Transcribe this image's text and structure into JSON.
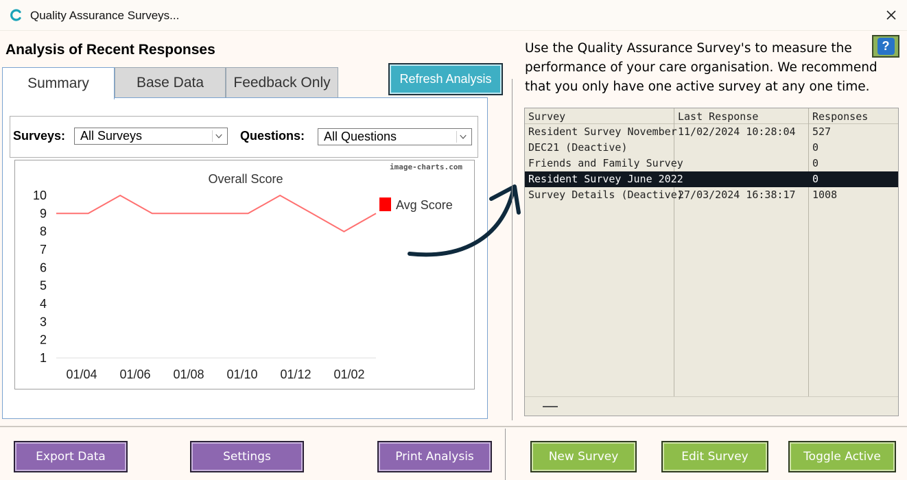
{
  "window": {
    "title": "Quality Assurance Surveys...",
    "close_label": "×"
  },
  "heading": "Analysis of Recent Responses",
  "tabs": [
    {
      "label": "Summary",
      "active": true
    },
    {
      "label": "Base Data",
      "active": false
    },
    {
      "label": "Feedback Only",
      "active": false
    }
  ],
  "refresh_button": "Refresh Analysis",
  "filters": {
    "surveys_label": "Surveys:",
    "surveys_value": "All Surveys",
    "questions_label": "Questions:",
    "questions_value": "All Questions"
  },
  "chart_data": {
    "type": "line",
    "title": "Overall Score",
    "watermark": "image-charts.com",
    "x_tick_labels": [
      "01/04",
      "01/06",
      "01/08",
      "01/10",
      "01/12",
      "01/02"
    ],
    "ylim": [
      1,
      10
    ],
    "y_ticks": [
      1,
      2,
      3,
      4,
      5,
      6,
      7,
      8,
      9,
      10
    ],
    "series": [
      {
        "name": "Avg Score",
        "color": "#ff7070",
        "values": [
          9,
          9,
          10,
          9,
          9,
          9,
          9,
          10,
          9,
          8,
          9
        ]
      }
    ],
    "legend": {
      "position": "right",
      "swatch_color": "#ff0000"
    },
    "grid": false
  },
  "intro_text": "Use the Quality Assurance Survey's to measure the performance of your care organisation.  We recommend that you only have one active survey at any one time.",
  "help_label": "?",
  "survey_list": {
    "columns": [
      "Survey",
      "Last Response",
      "Responses"
    ],
    "rows": [
      {
        "survey": "Resident Survey November",
        "last_response": "11/02/2024 10:28:04",
        "responses": "527",
        "selected": false
      },
      {
        "survey": "DEC21 (Deactive)",
        "last_response": "",
        "responses": "0",
        "selected": false
      },
      {
        "survey": "Friends and Family Survey",
        "last_response": "",
        "responses": "0",
        "selected": false
      },
      {
        "survey": "Resident Survey June 2022",
        "last_response": "",
        "responses": "0",
        "selected": true
      },
      {
        "survey": "Survey Details (Deactive)",
        "last_response": "27/03/2024 16:38:17",
        "responses": "1008",
        "selected": false
      }
    ]
  },
  "buttons": {
    "export": "Export Data",
    "settings": "Settings",
    "print": "Print Analysis",
    "new_survey": "New Survey",
    "edit_survey": "Edit Survey",
    "toggle_active": "Toggle Active"
  },
  "colors": {
    "purple_button": "#8d67b0",
    "green_button": "#8ebd4a",
    "refresh_button": "#3eafc4",
    "selected_row": "#111820",
    "annotation_arrow": "#0f2a3d"
  }
}
